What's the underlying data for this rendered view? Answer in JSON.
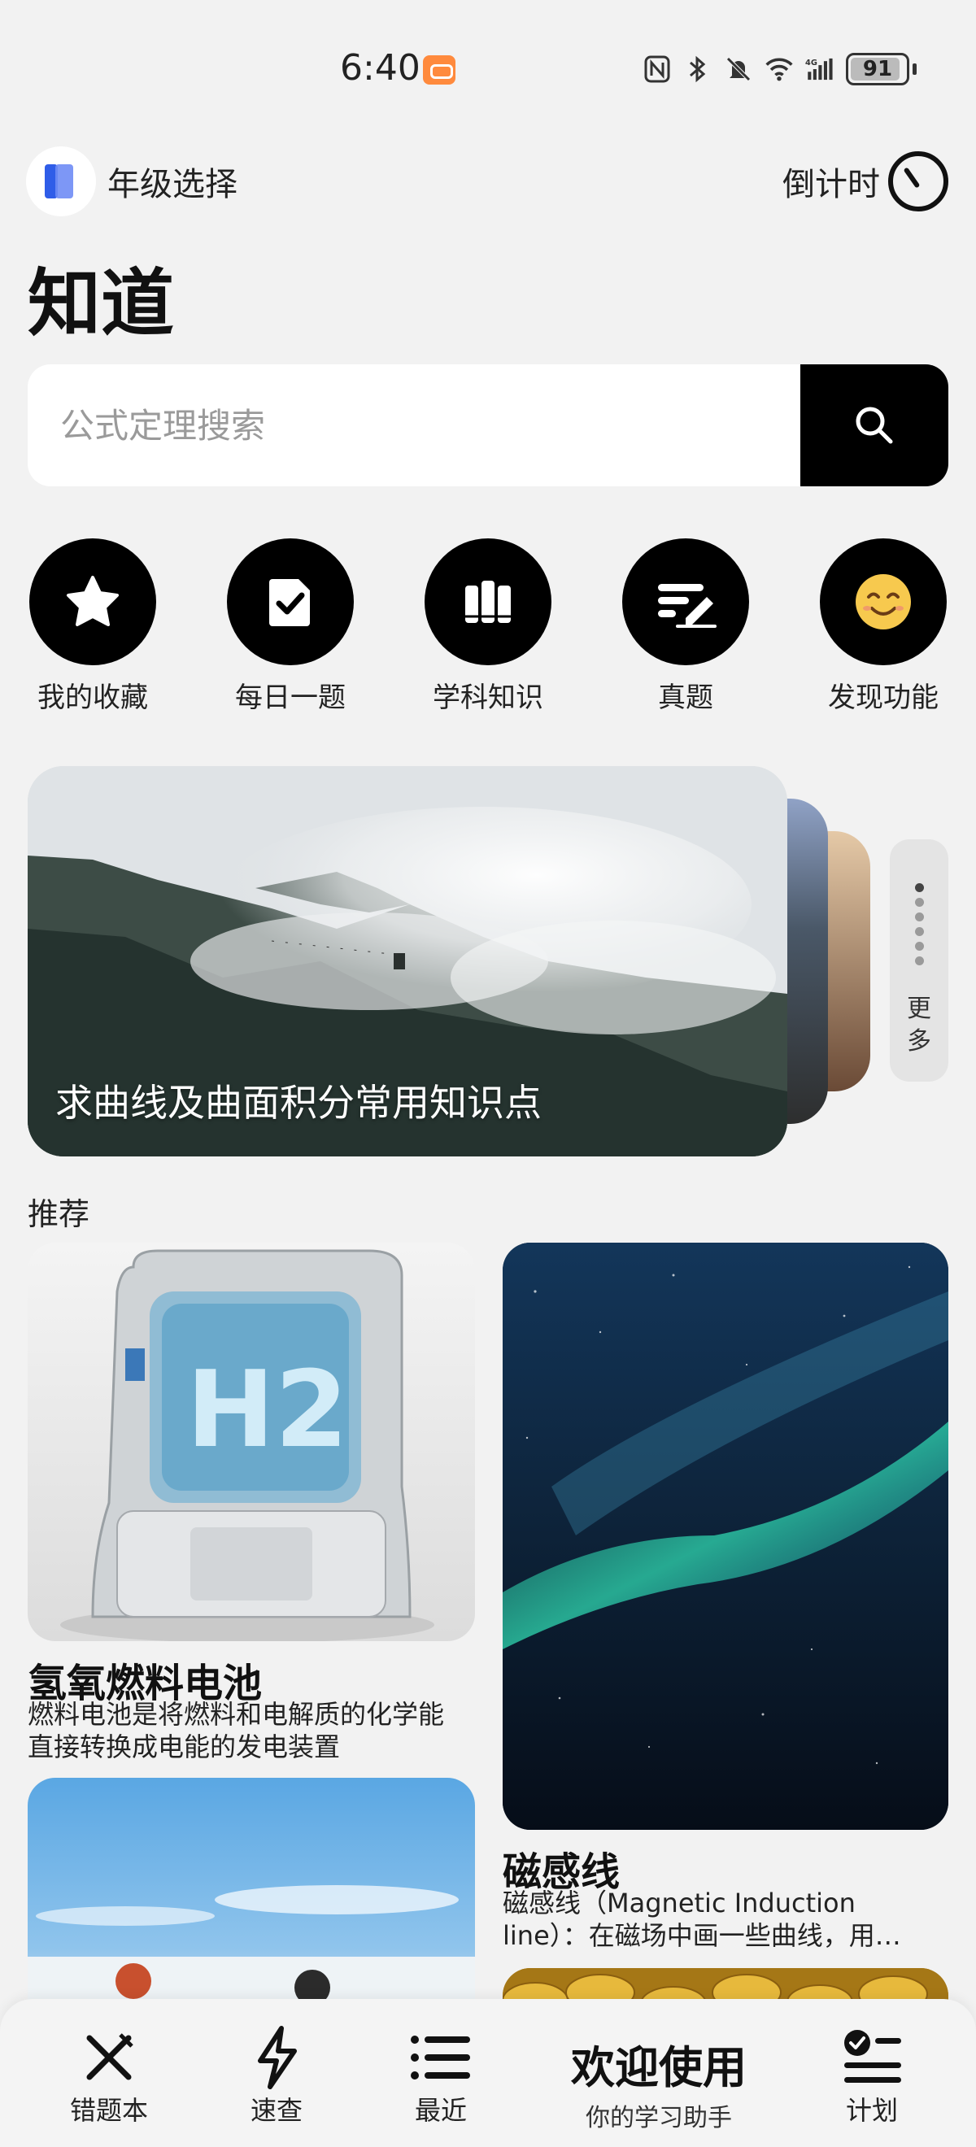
{
  "status_bar": {
    "time": "6:40",
    "battery": "91",
    "battery_level": 0.91,
    "network": "4G"
  },
  "header": {
    "grade_label": "年级选择",
    "countdown_label": "倒计时",
    "title": "知道"
  },
  "search": {
    "placeholder": "公式定理搜索"
  },
  "quick_actions": [
    {
      "label": "我的收藏",
      "icon": "star-icon"
    },
    {
      "label": "每日一题",
      "icon": "checked-document-icon"
    },
    {
      "label": "学科知识",
      "icon": "books-icon"
    },
    {
      "label": "真题",
      "icon": "pen-lines-icon"
    },
    {
      "label": "发现功能",
      "icon": "smile-emoji-icon"
    }
  ],
  "banner": {
    "caption": "求曲线及曲面积分常用知识点",
    "more_label": "更多",
    "dot_count": 6,
    "active_dot": 1
  },
  "recommend": {
    "title": "推荐",
    "cards": [
      {
        "title": "氢氧燃料电池",
        "desc_line1": "燃料电池是将燃料和电解质的化学能",
        "desc_line2": "直接转换成电能的发电装置",
        "image": "hydrogen-fuel-cell-image",
        "image_text": "H2"
      },
      {
        "title": "磁感线",
        "desc_line1": "磁感线（Magnetic Induction",
        "desc_line2": "line）：在磁场中画一些曲线，用…",
        "image": "aurora-image"
      },
      {
        "image": "mountain-snow-image"
      },
      {
        "image": "gold-coins-image"
      }
    ]
  },
  "bottom_nav": {
    "mistakes": "错题本",
    "quick_lookup": "速查",
    "recent": "最近",
    "welcome_title": "欢迎使用",
    "welcome_sub": "你的学习助手",
    "plan": "计划"
  },
  "colors": {
    "background": "#f2f2f2",
    "accent_black": "#000000",
    "card_bg": "#ffffff",
    "emoji_yellow": "#f7c94e"
  }
}
